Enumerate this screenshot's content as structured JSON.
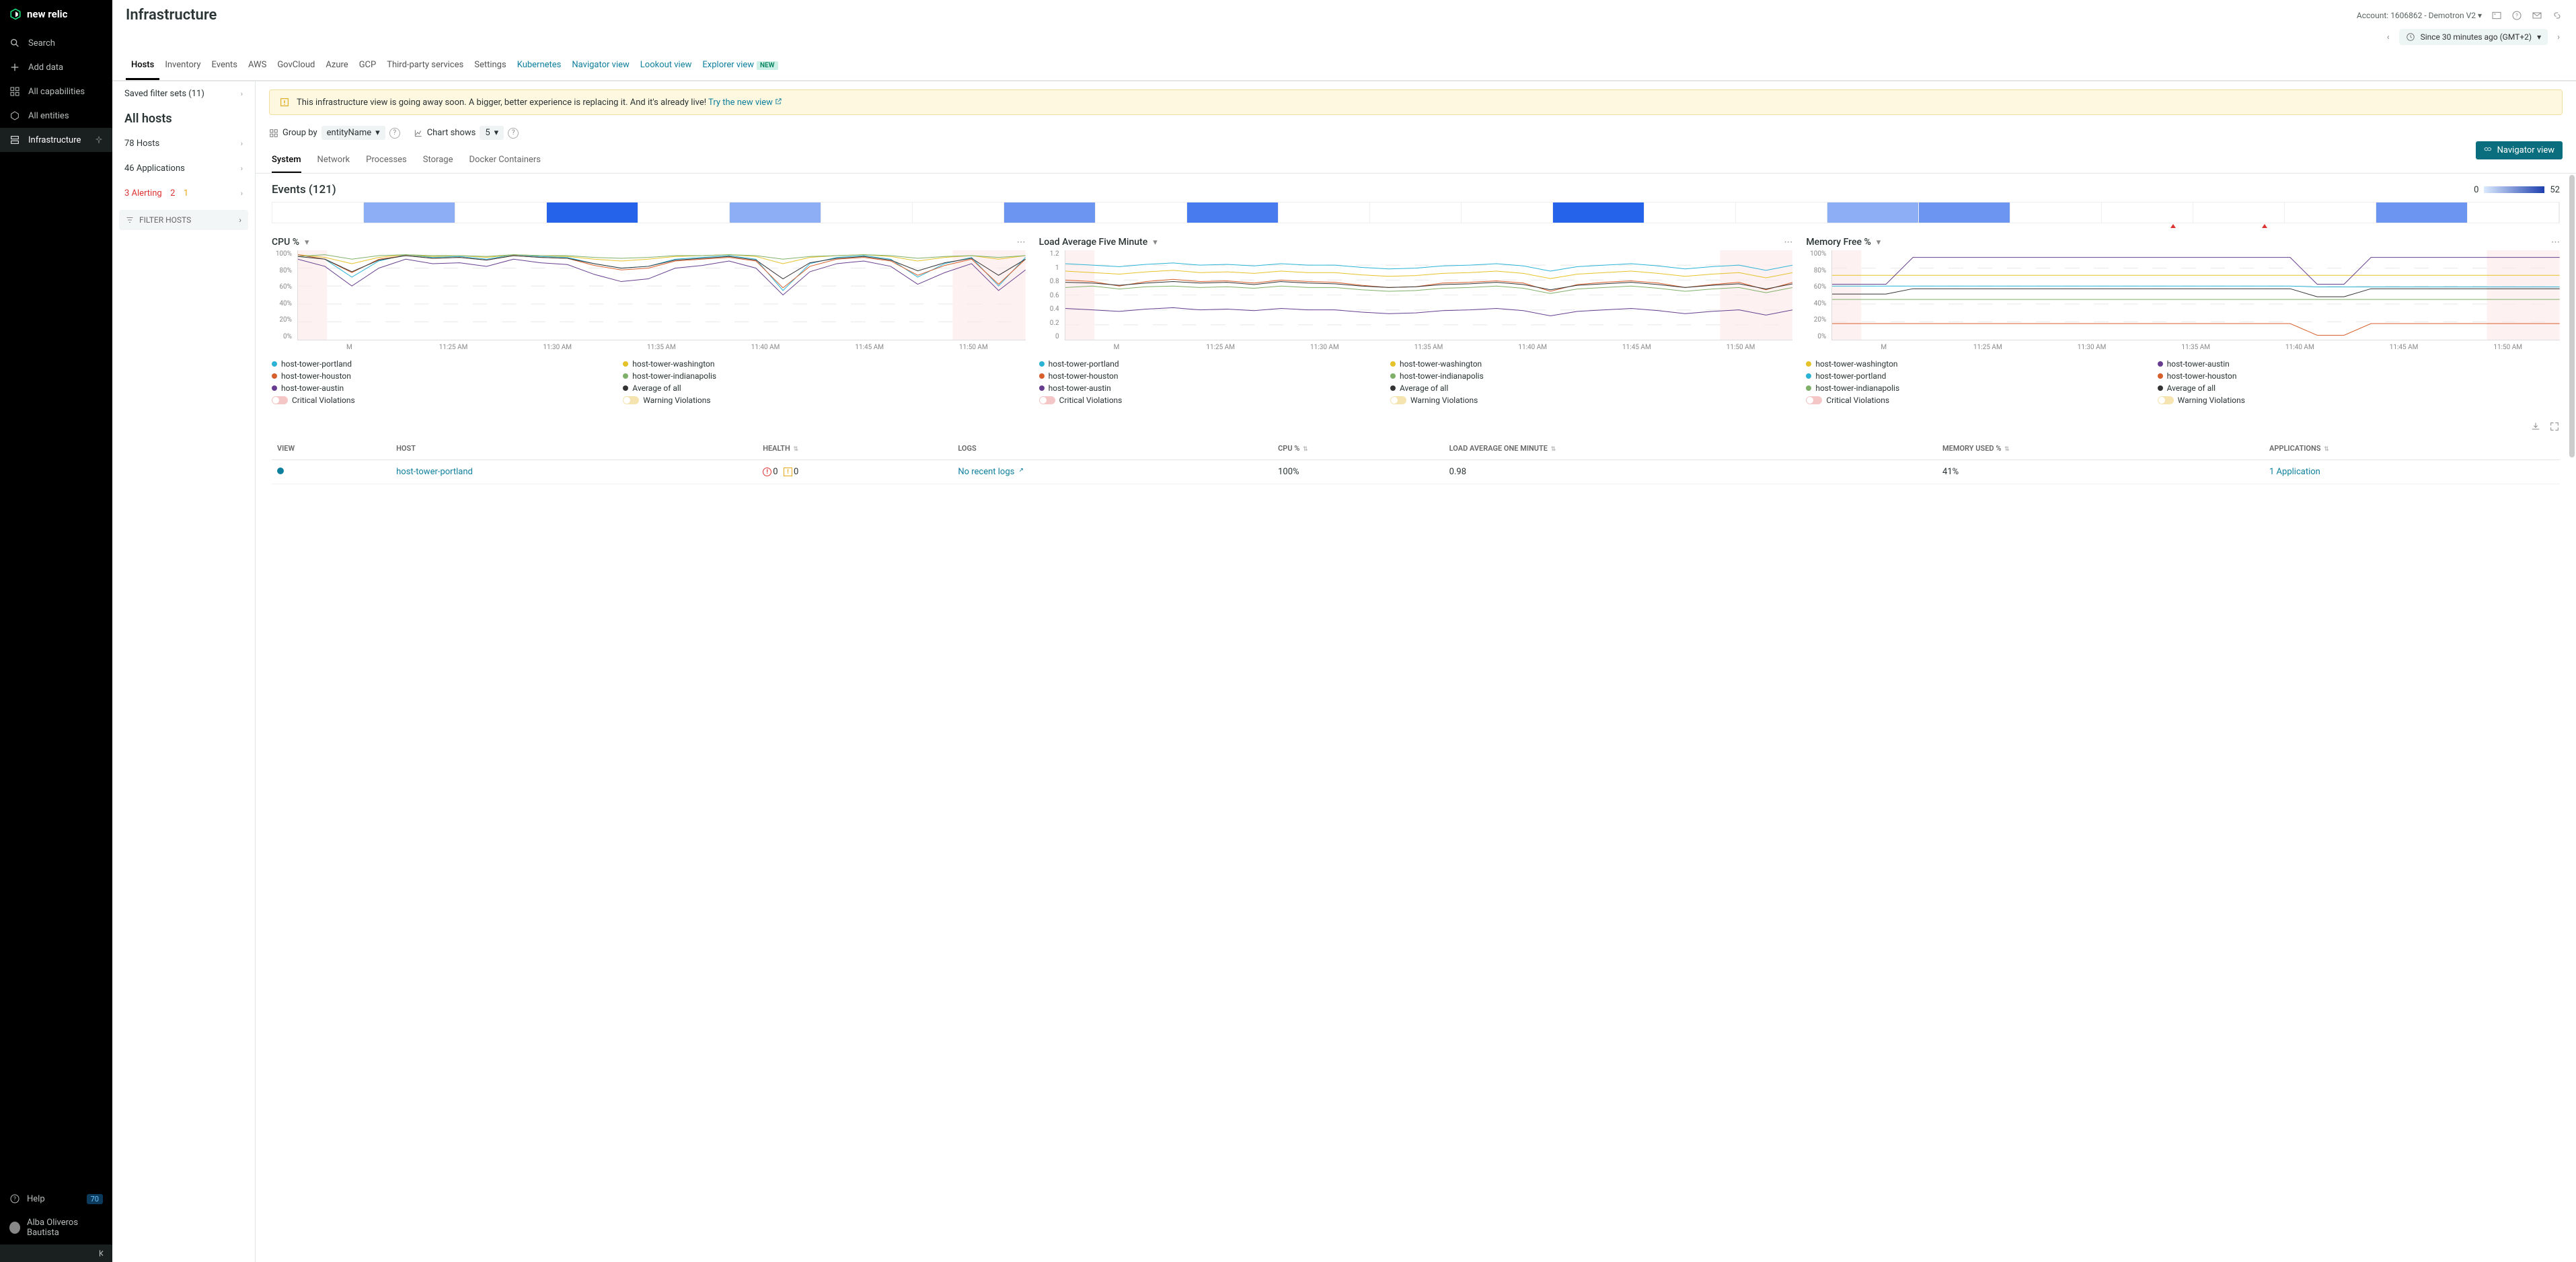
{
  "brand": "new relic",
  "page_title": "Infrastructure",
  "account": {
    "label": "Account: 1606862 - Demotron V2"
  },
  "time_range": "Since 30 minutes ago (GMT+2)",
  "sidebar": {
    "search": "Search",
    "add_data": "Add data",
    "all_capabilities": "All capabilities",
    "all_entities": "All entities",
    "infrastructure": "Infrastructure",
    "help": "Help",
    "help_count": "70",
    "user": "Alba Oliveros Bautista"
  },
  "tabs": [
    {
      "label": "Hosts",
      "active": true
    },
    {
      "label": "Inventory"
    },
    {
      "label": "Events"
    },
    {
      "label": "AWS"
    },
    {
      "label": "GovCloud"
    },
    {
      "label": "Azure"
    },
    {
      "label": "GCP"
    },
    {
      "label": "Third-party services"
    },
    {
      "label": "Settings"
    },
    {
      "label": "Kubernetes",
      "link": true
    },
    {
      "label": "Navigator view",
      "link": true
    },
    {
      "label": "Lookout view",
      "link": true
    },
    {
      "label": "Explorer view",
      "link": true,
      "new": "NEW"
    }
  ],
  "left_panel": {
    "saved_filter": "Saved filter sets (11)",
    "all_hosts": "All hosts",
    "hosts": "78 Hosts",
    "apps": "46 Applications",
    "alerting": "3 Alerting",
    "alert_red": "2",
    "alert_orange": "1",
    "filter_hosts": "FILTER HOSTS"
  },
  "banner": {
    "text": "This infrastructure view is going away soon. A bigger, better experience is replacing it. And it's already live! ",
    "link": "Try the new view"
  },
  "controls": {
    "group_by_label": "Group by",
    "group_by_value": "entityName",
    "chart_shows_label": "Chart shows",
    "chart_shows_value": "5"
  },
  "subtabs": [
    "System",
    "Network",
    "Processes",
    "Storage",
    "Docker Containers"
  ],
  "nav_view_btn": "Navigator view",
  "events": {
    "title": "Events (121)",
    "min": "0",
    "max": "52",
    "heatmap": [
      0,
      2,
      0,
      5,
      0,
      2,
      0,
      0,
      3,
      0,
      4,
      0,
      0,
      0,
      5,
      0,
      0,
      2,
      3,
      0,
      0,
      0,
      0,
      3,
      0
    ]
  },
  "hosts_legend": [
    "host-tower-portland",
    "host-tower-washington",
    "host-tower-houston",
    "host-tower-indianapolis",
    "host-tower-austin",
    "Average of all"
  ],
  "toggle_labels": {
    "crit": "Critical Violations",
    "warn": "Warning Violations"
  },
  "chart_data": [
    {
      "type": "line",
      "title": "CPU %",
      "ylim": [
        0,
        100
      ],
      "yticks": [
        "100%",
        "80%",
        "60%",
        "40%",
        "20%",
        "0%"
      ],
      "xlabel_first": "M",
      "xticks": [
        "11:25 AM",
        "11:30 AM",
        "11:35 AM",
        "11:40 AM",
        "11:45 AM",
        "11:50 AM"
      ],
      "series": [
        {
          "name": "host-tower-portland",
          "color": "#2bb3d6",
          "values": [
            95,
            90,
            70,
            88,
            95,
            92,
            93,
            90,
            95,
            93,
            92,
            85,
            80,
            82,
            90,
            92,
            94,
            90,
            55,
            85,
            92,
            94,
            90,
            70,
            85,
            92,
            60,
            92
          ]
        },
        {
          "name": "host-tower-washington",
          "color": "#e6c229",
          "values": [
            95,
            92,
            85,
            92,
            95,
            93,
            94,
            92,
            95,
            94,
            93,
            90,
            88,
            90,
            93,
            94,
            95,
            93,
            85,
            92,
            94,
            95,
            93,
            88,
            92,
            94,
            90,
            94
          ]
        },
        {
          "name": "host-tower-houston",
          "color": "#d65f2b",
          "values": [
            95,
            90,
            75,
            90,
            94,
            91,
            92,
            89,
            94,
            92,
            91,
            83,
            78,
            80,
            88,
            90,
            92,
            88,
            58,
            82,
            90,
            92,
            88,
            72,
            83,
            90,
            62,
            90
          ]
        },
        {
          "name": "host-tower-indianapolis",
          "color": "#7fb069",
          "values": [
            93,
            95,
            90,
            94,
            95,
            94,
            94,
            93,
            95,
            94,
            94,
            92,
            91,
            92,
            94,
            94,
            95,
            94,
            90,
            93,
            94,
            95,
            94,
            91,
            93,
            94,
            92,
            94
          ]
        },
        {
          "name": "host-tower-austin",
          "color": "#673e8f",
          "values": [
            90,
            82,
            60,
            80,
            90,
            85,
            86,
            82,
            90,
            86,
            84,
            73,
            65,
            68,
            80,
            83,
            88,
            80,
            50,
            76,
            85,
            88,
            82,
            62,
            75,
            85,
            55,
            78
          ]
        },
        {
          "name": "Average of all",
          "color": "#333333",
          "values": [
            93,
            90,
            76,
            89,
            94,
            91,
            92,
            89,
            94,
            92,
            91,
            85,
            80,
            82,
            89,
            91,
            93,
            89,
            68,
            86,
            91,
            93,
            89,
            77,
            86,
            91,
            72,
            90
          ]
        }
      ]
    },
    {
      "type": "line",
      "title": "Load Average Five Minute",
      "ylim": [
        0,
        1.2
      ],
      "yticks": [
        "1.2",
        "1",
        "0.8",
        "0.6",
        "0.4",
        "0.2",
        "0"
      ],
      "xlabel_first": "M",
      "xticks": [
        "11:25 AM",
        "11:30 AM",
        "11:35 AM",
        "11:40 AM",
        "11:45 AM",
        "11:50 AM"
      ],
      "series": [
        {
          "name": "host-tower-portland",
          "color": "#2bb3d6",
          "values": [
            1.02,
            1.0,
            0.98,
            1.01,
            1.03,
            1.0,
            1.01,
            0.99,
            1.02,
            1.0,
            1.0,
            0.97,
            0.95,
            0.96,
            0.99,
            1.0,
            1.02,
            0.99,
            0.92,
            0.98,
            1.0,
            1.02,
            0.99,
            0.95,
            0.98,
            1.0,
            0.93,
            1.0
          ]
        },
        {
          "name": "host-tower-washington",
          "color": "#e6c229",
          "values": [
            0.92,
            0.9,
            0.88,
            0.91,
            0.93,
            0.9,
            0.91,
            0.89,
            0.92,
            0.9,
            0.9,
            0.87,
            0.85,
            0.86,
            0.89,
            0.9,
            0.92,
            0.89,
            0.82,
            0.88,
            0.9,
            0.92,
            0.89,
            0.85,
            0.88,
            0.9,
            0.83,
            0.9
          ]
        },
        {
          "name": "host-tower-houston",
          "color": "#d65f2b",
          "values": [
            0.8,
            0.78,
            0.72,
            0.78,
            0.81,
            0.78,
            0.79,
            0.76,
            0.8,
            0.78,
            0.77,
            0.73,
            0.7,
            0.71,
            0.76,
            0.77,
            0.79,
            0.76,
            0.65,
            0.74,
            0.77,
            0.79,
            0.76,
            0.7,
            0.74,
            0.77,
            0.67,
            0.77
          ]
        },
        {
          "name": "host-tower-indianapolis",
          "color": "#7fb069",
          "values": [
            0.7,
            0.72,
            0.68,
            0.71,
            0.72,
            0.7,
            0.71,
            0.69,
            0.72,
            0.7,
            0.7,
            0.67,
            0.65,
            0.66,
            0.69,
            0.7,
            0.72,
            0.69,
            0.62,
            0.68,
            0.7,
            0.72,
            0.69,
            0.65,
            0.68,
            0.7,
            0.63,
            0.7
          ]
        },
        {
          "name": "host-tower-austin",
          "color": "#673e8f",
          "values": [
            0.42,
            0.4,
            0.38,
            0.41,
            0.43,
            0.4,
            0.41,
            0.39,
            0.42,
            0.4,
            0.4,
            0.37,
            0.35,
            0.36,
            0.39,
            0.4,
            0.42,
            0.39,
            0.32,
            0.38,
            0.4,
            0.42,
            0.39,
            0.35,
            0.38,
            0.4,
            0.33,
            0.4
          ]
        },
        {
          "name": "Average of all",
          "color": "#333333",
          "values": [
            0.77,
            0.76,
            0.73,
            0.76,
            0.78,
            0.76,
            0.77,
            0.74,
            0.78,
            0.76,
            0.75,
            0.72,
            0.7,
            0.71,
            0.74,
            0.75,
            0.77,
            0.74,
            0.67,
            0.73,
            0.75,
            0.77,
            0.74,
            0.7,
            0.73,
            0.75,
            0.68,
            0.75
          ]
        }
      ]
    },
    {
      "type": "line",
      "title": "Memory Free %",
      "ylim": [
        0,
        100
      ],
      "yticks": [
        "100%",
        "80%",
        "60%",
        "40%",
        "20%",
        "0%"
      ],
      "xlabel_first": "M",
      "xticks": [
        "11:25 AM",
        "11:30 AM",
        "11:35 AM",
        "11:40 AM",
        "11:45 AM",
        "11:50 AM"
      ],
      "series": [
        {
          "name": "host-tower-washington",
          "color": "#e6c229",
          "values": [
            72,
            72,
            72,
            72,
            72,
            72,
            72,
            72,
            72,
            72,
            72,
            72,
            72,
            72,
            72,
            72,
            72,
            72,
            72,
            72,
            72,
            72,
            72,
            72,
            72,
            72,
            72,
            72
          ]
        },
        {
          "name": "host-tower-austin",
          "color": "#673e8f",
          "values": [
            62,
            62,
            62,
            92,
            92,
            92,
            92,
            92,
            92,
            92,
            92,
            92,
            92,
            92,
            92,
            92,
            92,
            92,
            62,
            62,
            92,
            92,
            92,
            92,
            92,
            92,
            92,
            92
          ]
        },
        {
          "name": "host-tower-portland",
          "color": "#2bb3d6",
          "values": [
            60,
            60,
            60,
            60,
            60,
            60,
            60,
            60,
            60,
            60,
            60,
            60,
            60,
            60,
            60,
            60,
            60,
            60,
            59,
            59,
            59,
            59,
            59,
            59,
            59,
            59,
            59,
            59
          ]
        },
        {
          "name": "host-tower-houston",
          "color": "#d65f2b",
          "values": [
            18,
            18,
            18,
            18,
            18,
            18,
            18,
            18,
            18,
            18,
            18,
            18,
            18,
            18,
            18,
            18,
            18,
            18,
            5,
            5,
            18,
            18,
            18,
            18,
            18,
            18,
            18,
            18
          ]
        },
        {
          "name": "host-tower-indianapolis",
          "color": "#7fb069",
          "values": [
            45,
            45,
            45,
            45,
            45,
            45,
            45,
            45,
            45,
            45,
            45,
            45,
            45,
            45,
            45,
            45,
            45,
            45,
            45,
            45,
            45,
            45,
            45,
            45,
            45,
            45,
            45,
            45
          ]
        },
        {
          "name": "Average of all",
          "color": "#333333",
          "values": [
            51,
            51,
            51,
            57,
            57,
            57,
            57,
            57,
            57,
            57,
            57,
            57,
            57,
            57,
            57,
            57,
            57,
            57,
            48,
            48,
            57,
            57,
            57,
            57,
            57,
            57,
            57,
            57
          ]
        }
      ]
    }
  ],
  "table": {
    "headers": [
      "VIEW",
      "HOST",
      "HEALTH",
      "LOGS",
      "CPU %",
      "LOAD AVERAGE ONE MINUTE",
      "MEMORY USED %",
      "APPLICATIONS"
    ],
    "rows": [
      {
        "host": "host-tower-portland",
        "health_red": "0",
        "health_yel": "0",
        "logs": "No recent logs",
        "cpu": "100%",
        "load": "0.98",
        "mem": "41%",
        "apps": "1 Application"
      }
    ]
  }
}
